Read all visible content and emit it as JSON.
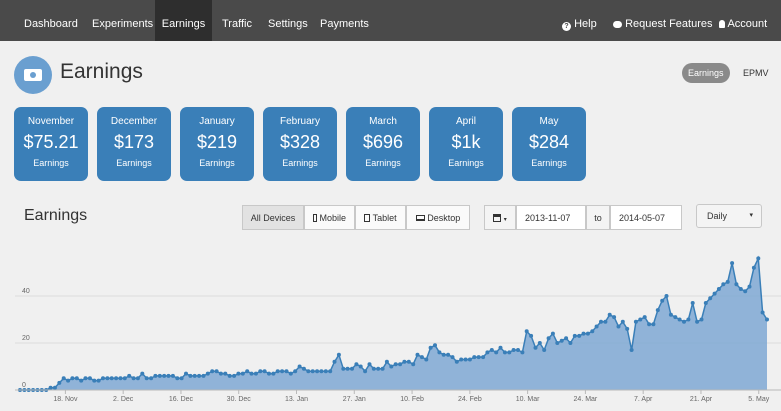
{
  "nav": {
    "left": [
      "Dashboard",
      "Experiments",
      "Earnings",
      "Traffic",
      "Settings",
      "Payments"
    ],
    "active": "Earnings",
    "help": "Help",
    "request": "Request Features",
    "account": "Account"
  },
  "page": {
    "title": "Earnings"
  },
  "toggles": {
    "earnings": "Earnings",
    "epmv": "EPMV",
    "active": "Earnings"
  },
  "cards": [
    {
      "month": "November",
      "value": "$75.21",
      "label": "Earnings"
    },
    {
      "month": "December",
      "value": "$173",
      "label": "Earnings"
    },
    {
      "month": "January",
      "value": "$219",
      "label": "Earnings"
    },
    {
      "month": "February",
      "value": "$328",
      "label": "Earnings"
    },
    {
      "month": "March",
      "value": "$696",
      "label": "Earnings"
    },
    {
      "month": "April",
      "value": "$1k",
      "label": "Earnings"
    },
    {
      "month": "May",
      "value": "$284",
      "label": "Earnings"
    }
  ],
  "section": {
    "title": "Earnings"
  },
  "devices": {
    "all": "All Devices",
    "mobile": "Mobile",
    "tablet": "Tablet",
    "desktop": "Desktop",
    "active": "All Devices"
  },
  "dates": {
    "from": "2013-11-07",
    "to_label": "to",
    "to": "2014-05-07"
  },
  "interval": {
    "selected": "Daily"
  },
  "colors": {
    "nav_bg": "#4a4a4a",
    "card_bg": "#3a7fb8",
    "series": "#3a7fb8",
    "area": "#7fa8d4"
  },
  "chart_data": {
    "type": "area",
    "x_start": "2013-11-07",
    "x_end": "2014-05-07",
    "ylim": [
      0,
      58
    ],
    "yticks": [
      0,
      20,
      40
    ],
    "xtick_labels": [
      {
        "label": "18. Nov",
        "date": "2013-11-18"
      },
      {
        "label": "2. Dec",
        "date": "2013-12-02"
      },
      {
        "label": "16. Dec",
        "date": "2013-12-16"
      },
      {
        "label": "30. Dec",
        "date": "2013-12-30"
      },
      {
        "label": "13. Jan",
        "date": "2014-01-13"
      },
      {
        "label": "27. Jan",
        "date": "2014-01-27"
      },
      {
        "label": "10. Feb",
        "date": "2014-02-10"
      },
      {
        "label": "24. Feb",
        "date": "2014-02-24"
      },
      {
        "label": "10. Mar",
        "date": "2014-03-10"
      },
      {
        "label": "24. Mar",
        "date": "2014-03-24"
      },
      {
        "label": "7. Apr",
        "date": "2014-04-07"
      },
      {
        "label": "21. Apr",
        "date": "2014-04-21"
      },
      {
        "label": "5. May",
        "date": "2014-05-05"
      }
    ],
    "grid": true,
    "series": [
      {
        "values": [
          0,
          0,
          0,
          0,
          0,
          0,
          0,
          1,
          1,
          3,
          5,
          4,
          5,
          5,
          4,
          5,
          5,
          4,
          4,
          5,
          5,
          5,
          5,
          5,
          5,
          6,
          5,
          5,
          7,
          5,
          5,
          6,
          6,
          6,
          6,
          6,
          5,
          5,
          7,
          6,
          6,
          6,
          6,
          7,
          8,
          8,
          7,
          7,
          6,
          6,
          7,
          7,
          8,
          7,
          7,
          8,
          8,
          7,
          7,
          8,
          8,
          8,
          7,
          8,
          10,
          9,
          8,
          8,
          8,
          8,
          8,
          8,
          12,
          15,
          9,
          9,
          9,
          11,
          10,
          8,
          11,
          9,
          9,
          9,
          12,
          10,
          11,
          11,
          12,
          12,
          11,
          15,
          14,
          13,
          18,
          19,
          16,
          15,
          15,
          14,
          12,
          13,
          13,
          13,
          14,
          14,
          14,
          16,
          17,
          16,
          18,
          16,
          16,
          17,
          17,
          16,
          25,
          23,
          18,
          20,
          17,
          22,
          24,
          20,
          21,
          22,
          20,
          23,
          23,
          24,
          24,
          25,
          27,
          29,
          29,
          32,
          31,
          27,
          29,
          26,
          17,
          29,
          30,
          31,
          28,
          28,
          34,
          38,
          40,
          32,
          31,
          30,
          29,
          30,
          37,
          29,
          30,
          37,
          39,
          41,
          43,
          45,
          46,
          54,
          45,
          43,
          42,
          44,
          52,
          56,
          33,
          30
        ]
      }
    ]
  }
}
